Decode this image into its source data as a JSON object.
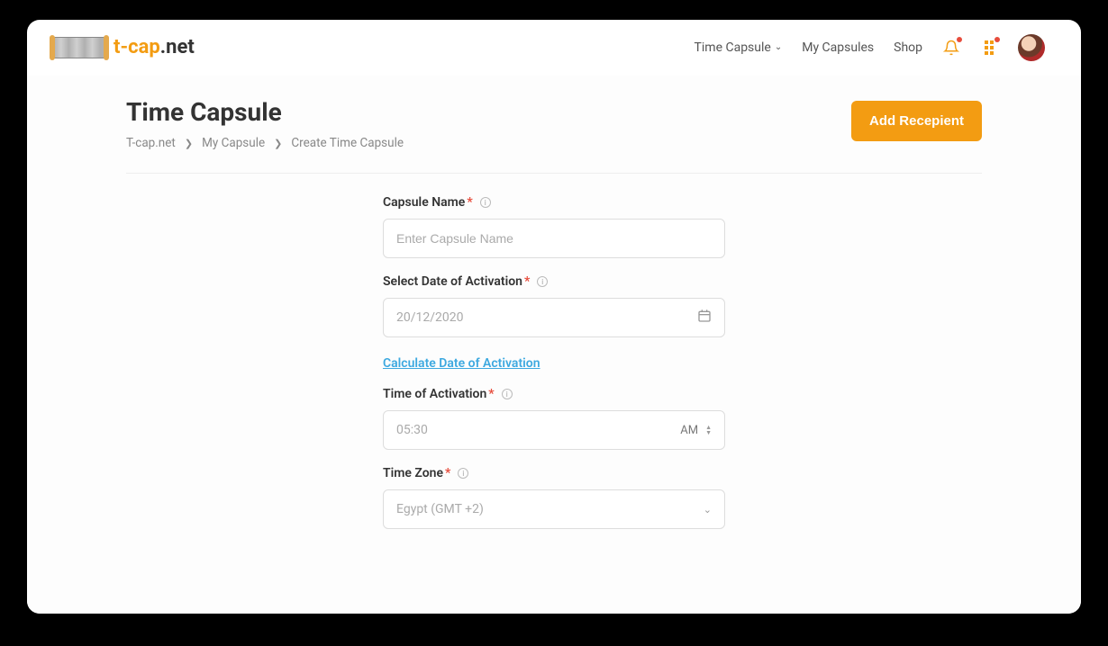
{
  "header": {
    "logo": {
      "text_accent": "t-cap",
      "text_rest": ".net"
    },
    "nav": {
      "time_capsule": "Time Capsule",
      "my_capsules": "My Capsules",
      "shop": "Shop"
    }
  },
  "page": {
    "title": "Time Capsule",
    "breadcrumb": {
      "root": "T-cap.net",
      "level1": "My Capsule",
      "level2": "Create Time Capsule"
    },
    "action_button": "Add Recepient"
  },
  "form": {
    "capsule_name": {
      "label": "Capsule Name",
      "placeholder": "Enter Capsule Name",
      "value": ""
    },
    "activation_date": {
      "label": "Select Date of Activation",
      "value": "20/12/2020"
    },
    "calculate_link": "Calculate Date of Activation",
    "activation_time": {
      "label": "Time of Activation",
      "value": "05:30",
      "period": "AM"
    },
    "timezone": {
      "label": "Time Zone",
      "value": "Egypt (GMT +2)"
    }
  }
}
